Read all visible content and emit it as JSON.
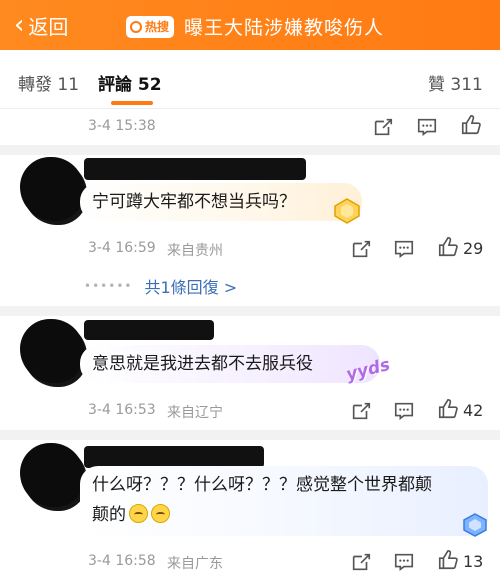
{
  "header": {
    "back_label": "返回",
    "hot_tag": "热搜",
    "title": "曝王大陆涉嫌教唆伤人"
  },
  "tabs": {
    "repost": "轉發 11",
    "comments": "評論 52",
    "likes": "贊 311"
  },
  "top_item": {
    "time": "3-4 15:38"
  },
  "comments": [
    {
      "text": "宁可蹲大牢都不想当兵吗？",
      "time": "3-4 16:59",
      "location": "来自贵州",
      "likes": "29",
      "replies_label": "共1條回復 >"
    },
    {
      "text": "意思就是我进去都不去服兵役",
      "time": "3-4 16:53",
      "location": "来自辽宁",
      "likes": "42",
      "sticker": "yyds"
    },
    {
      "text_line1": "什么呀？？？什么呀？？？感觉整个世界都颠",
      "text_line2": "颠的",
      "time": "3-4 16:58",
      "location": "来自广东",
      "likes": "13"
    }
  ]
}
